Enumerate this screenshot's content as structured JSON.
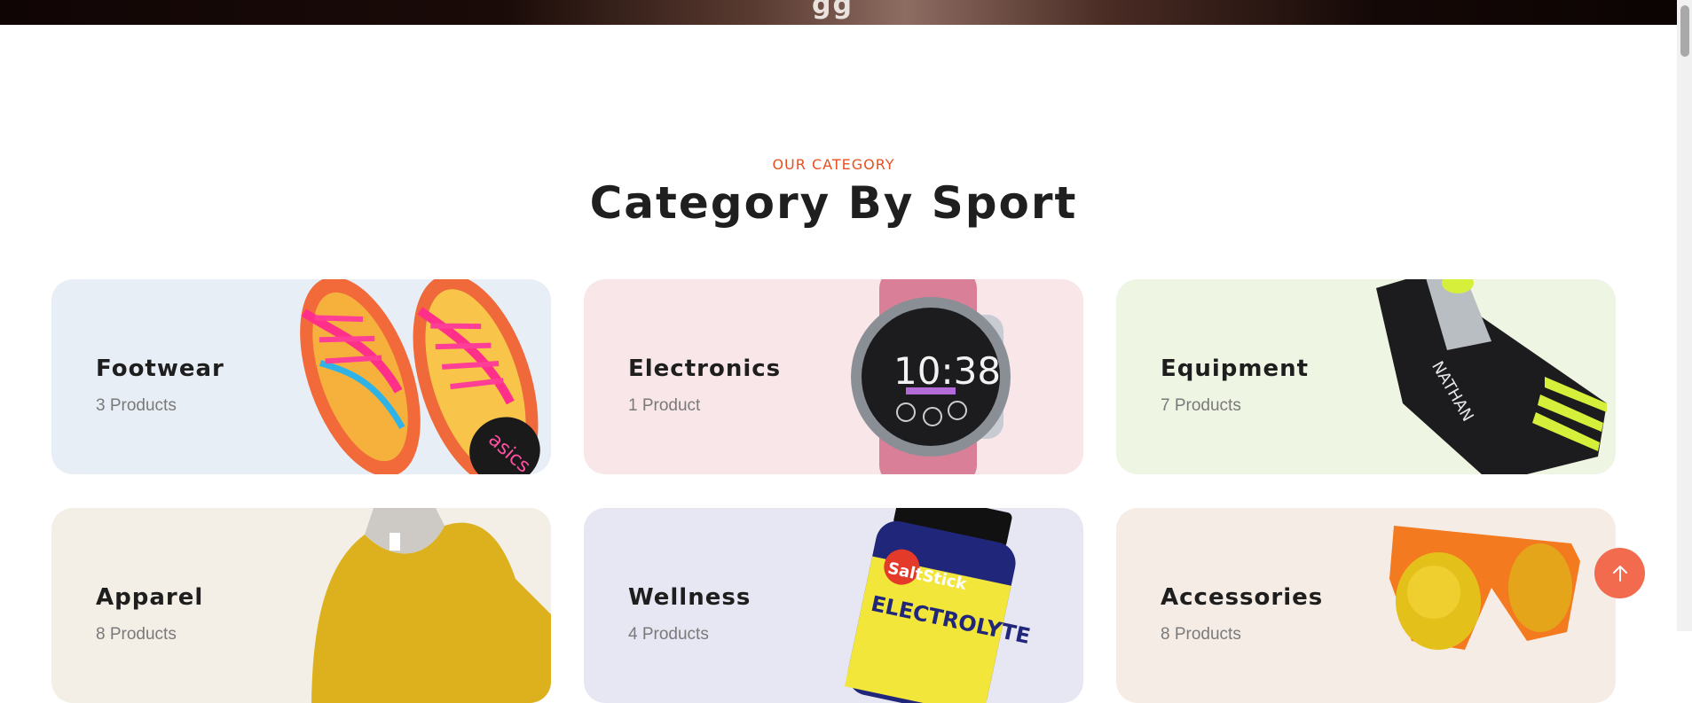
{
  "banner": {
    "glyph": "gg"
  },
  "section": {
    "eyebrow": "OUR CATEGORY",
    "title": "Category By Sport"
  },
  "categories": [
    {
      "name": "Footwear",
      "count": "3 Products",
      "bg": "#e8eef6",
      "icon": "running-shoes-image"
    },
    {
      "name": "Electronics",
      "count": "1 Product",
      "bg": "#f9e6e8",
      "icon": "sport-watch-image"
    },
    {
      "name": "Equipment",
      "count": "7 Products",
      "bg": "#eef5e3",
      "icon": "hydration-belt-image"
    },
    {
      "name": "Apparel",
      "count": "8 Products",
      "bg": "#f3efe6",
      "icon": "tank-top-image"
    },
    {
      "name": "Wellness",
      "count": "4 Products",
      "bg": "#e7e6f3",
      "icon": "electrolyte-bottle-image"
    },
    {
      "name": "Accessories",
      "count": "8 Products",
      "bg": "#f6ece6",
      "icon": "sunglasses-image"
    }
  ],
  "image_text": {
    "shoe_brand": "asics",
    "watch_time": "10:38",
    "belt_brand": "NATHAN",
    "bottle_brand": "SaltStick",
    "bottle_label": "ELECTROLYTE"
  },
  "back_to_top": {
    "icon": "arrow-up-icon",
    "color": "#f26b4f"
  }
}
